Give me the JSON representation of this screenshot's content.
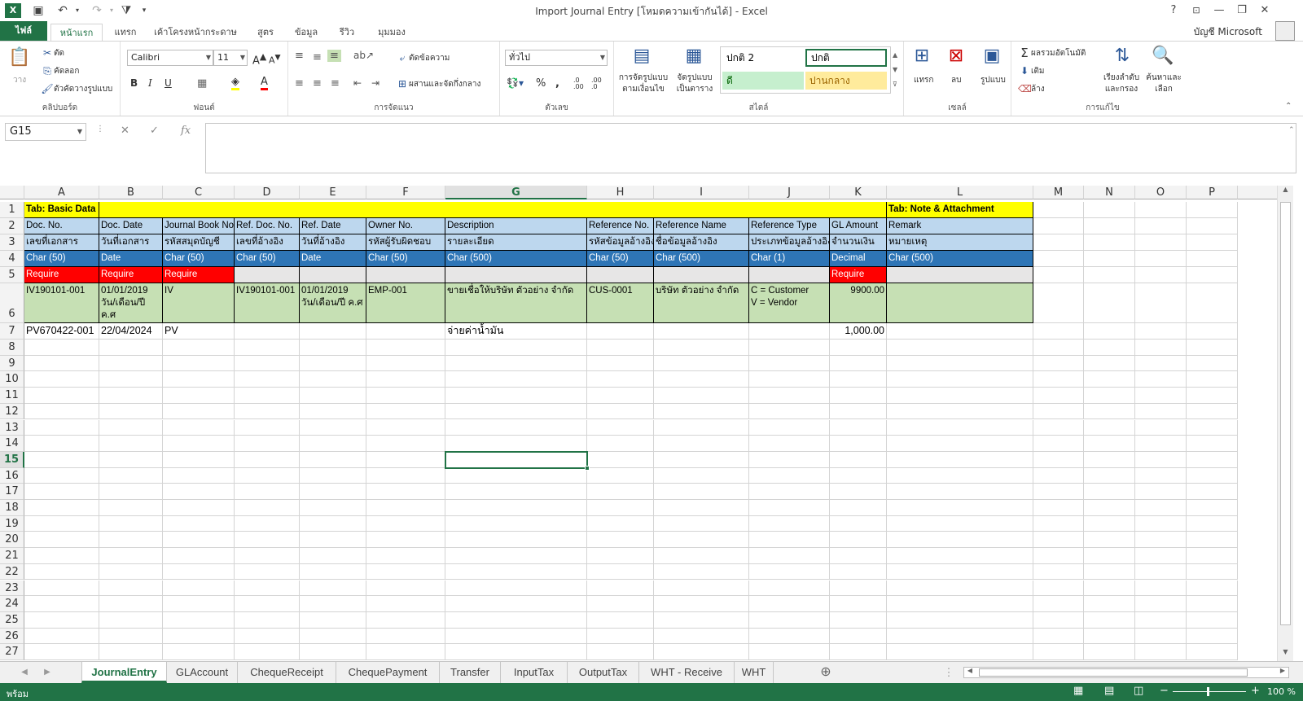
{
  "titlebar": {
    "title": "Import Journal Entry  [โหมดความเข้ากันได้] - Excel",
    "help": "?",
    "restore": "❐",
    "minimize": "—",
    "maximize": "❐",
    "close": "✕"
  },
  "ribbon_tabs": [
    "ไฟล์",
    "หน้าแรก",
    "แทรก",
    "เค้าโครงหน้ากระดาษ",
    "สูตร",
    "ข้อมูล",
    "รีวิว",
    "มุมมอง"
  ],
  "account": "บัญชี Microsoft",
  "ribbon": {
    "clipboard": {
      "paste": "วาง",
      "cut": "ตัด",
      "copy": "คัดลอก",
      "format_painter": "ตัวคัดวางรูปแบบ",
      "label": "คลิปบอร์ด"
    },
    "font": {
      "name": "Calibri",
      "size": "11",
      "bold": "B",
      "italic": "I",
      "underline": "U",
      "label": "ฟอนต์"
    },
    "alignment": {
      "wrap": "ตัดข้อความ",
      "merge": "ผสานและจัดกึ่งกลาง",
      "label": "การจัดแนว"
    },
    "number": {
      "format": "ทั่วไป",
      "percent": "%",
      "comma": ",",
      "label": "ตัวเลข"
    },
    "styles": {
      "cond": "การจัดรูปแบบ ตามเงื่อนไข",
      "table": "จัดรูปแบบ เป็นตาราง",
      "s1": "ปกติ 2",
      "s2": "ปกติ",
      "s3": "ดี",
      "s4": "ปานกลาง",
      "label": "สไตล์"
    },
    "cells": {
      "insert": "แทรก",
      "delete": "ลบ",
      "format": "รูปแบบ",
      "label": "เซลล์"
    },
    "editing": {
      "autosum": "ผลรวมอัตโนมัติ",
      "fill": "เติม",
      "clear": "ล้าง",
      "sort": "เรียงลำดับ และกรอง",
      "find": "ค้นหาและ เลือก",
      "label": "การแก้ไข"
    }
  },
  "formula_bar": {
    "name_box": "G15",
    "fx": "fx",
    "formula": ""
  },
  "columns": [
    "A",
    "B",
    "C",
    "D",
    "E",
    "F",
    "G",
    "H",
    "I",
    "J",
    "K",
    "L",
    "M",
    "N",
    "O",
    "P"
  ],
  "rows": [
    "1",
    "2",
    "3",
    "4",
    "5",
    "6",
    "7",
    "8",
    "9",
    "10",
    "11",
    "12",
    "13",
    "14",
    "15",
    "16",
    "17",
    "18",
    "19",
    "20",
    "21",
    "22",
    "23",
    "24",
    "25",
    "26",
    "27"
  ],
  "cells": {
    "r1": {
      "A": "Tab: Basic Data",
      "L": "Tab: Note & Attachment"
    },
    "r2": {
      "A": "Doc. No.",
      "B": "Doc. Date",
      "C": "Journal Book No.",
      "D": "Ref. Doc. No.",
      "E": "Ref. Date",
      "F": "Owner No.",
      "G": "Description",
      "H": "Reference No.",
      "I": "Reference Name",
      "J": "Reference Type",
      "K": "GL Amount",
      "L": "Remark"
    },
    "r3": {
      "A": "เลขที่เอกสาร",
      "B": "วันที่เอกสาร",
      "C": "รหัสสมุดบัญชี",
      "D": "เลขที่อ้างอิง",
      "E": "วันที่อ้างอิง",
      "F": "รหัสผู้รับผิดชอบ",
      "G": "รายละเอียด",
      "H": "รหัสข้อมูลอ้างอิง",
      "I": "ชื่อข้อมูลอ้างอิง",
      "J": "ประเภทข้อมูลอ้างอิง",
      "K": "จำนวนเงิน",
      "L": "หมายเหตุ"
    },
    "r4": {
      "A": "Char (50)",
      "B": "Date",
      "C": "Char (50)",
      "D": "Char (50)",
      "E": "Date",
      "F": "Char (50)",
      "G": "Char (500)",
      "H": "Char (50)",
      "I": "Char (500)",
      "J": "Char (1)",
      "K": "Decimal",
      "L": "Char (500)"
    },
    "r5": {
      "A": "Require",
      "B": "Require",
      "C": "Require",
      "K": "Require"
    },
    "r6": {
      "A": "IV190101-001",
      "B": "01/01/2019 วัน/เดือน/ปี ค.ศ",
      "C": "IV",
      "D": "IV190101-001",
      "E": "01/01/2019 วัน/เดือน/ปี ค.ศ",
      "F": "EMP-001",
      "G": "ขายเชื่อให้บริษัท ตัวอย่าง จำกัด",
      "H": "CUS-0001",
      "I": "บริษัท ตัวอย่าง จำกัด",
      "J1": "C = Customer",
      "J2": "V = Vendor",
      "K": "9900.00"
    },
    "r7": {
      "A": "PV670422-001",
      "B": "22/04/2024",
      "C": "PV",
      "G": "จ่ายค่าน้ำมัน",
      "K": "1,000.00"
    }
  },
  "sheets": [
    "JournalEntry",
    "GLAccount",
    "ChequeReceipt",
    "ChequePayment",
    "Transfer",
    "InputTax",
    "OutputTax",
    "WHT - Receive",
    "WHT"
  ],
  "status": {
    "ready": "พร้อม",
    "zoom": "100 %"
  },
  "colors": {
    "excel_green": "#217346",
    "yellow": "#ffff00",
    "light_blue": "#bdd7ee",
    "blue": "#2e75b6",
    "red": "#ff0000",
    "grey": "#e7e6e6",
    "light_green": "#c6e0b4"
  }
}
